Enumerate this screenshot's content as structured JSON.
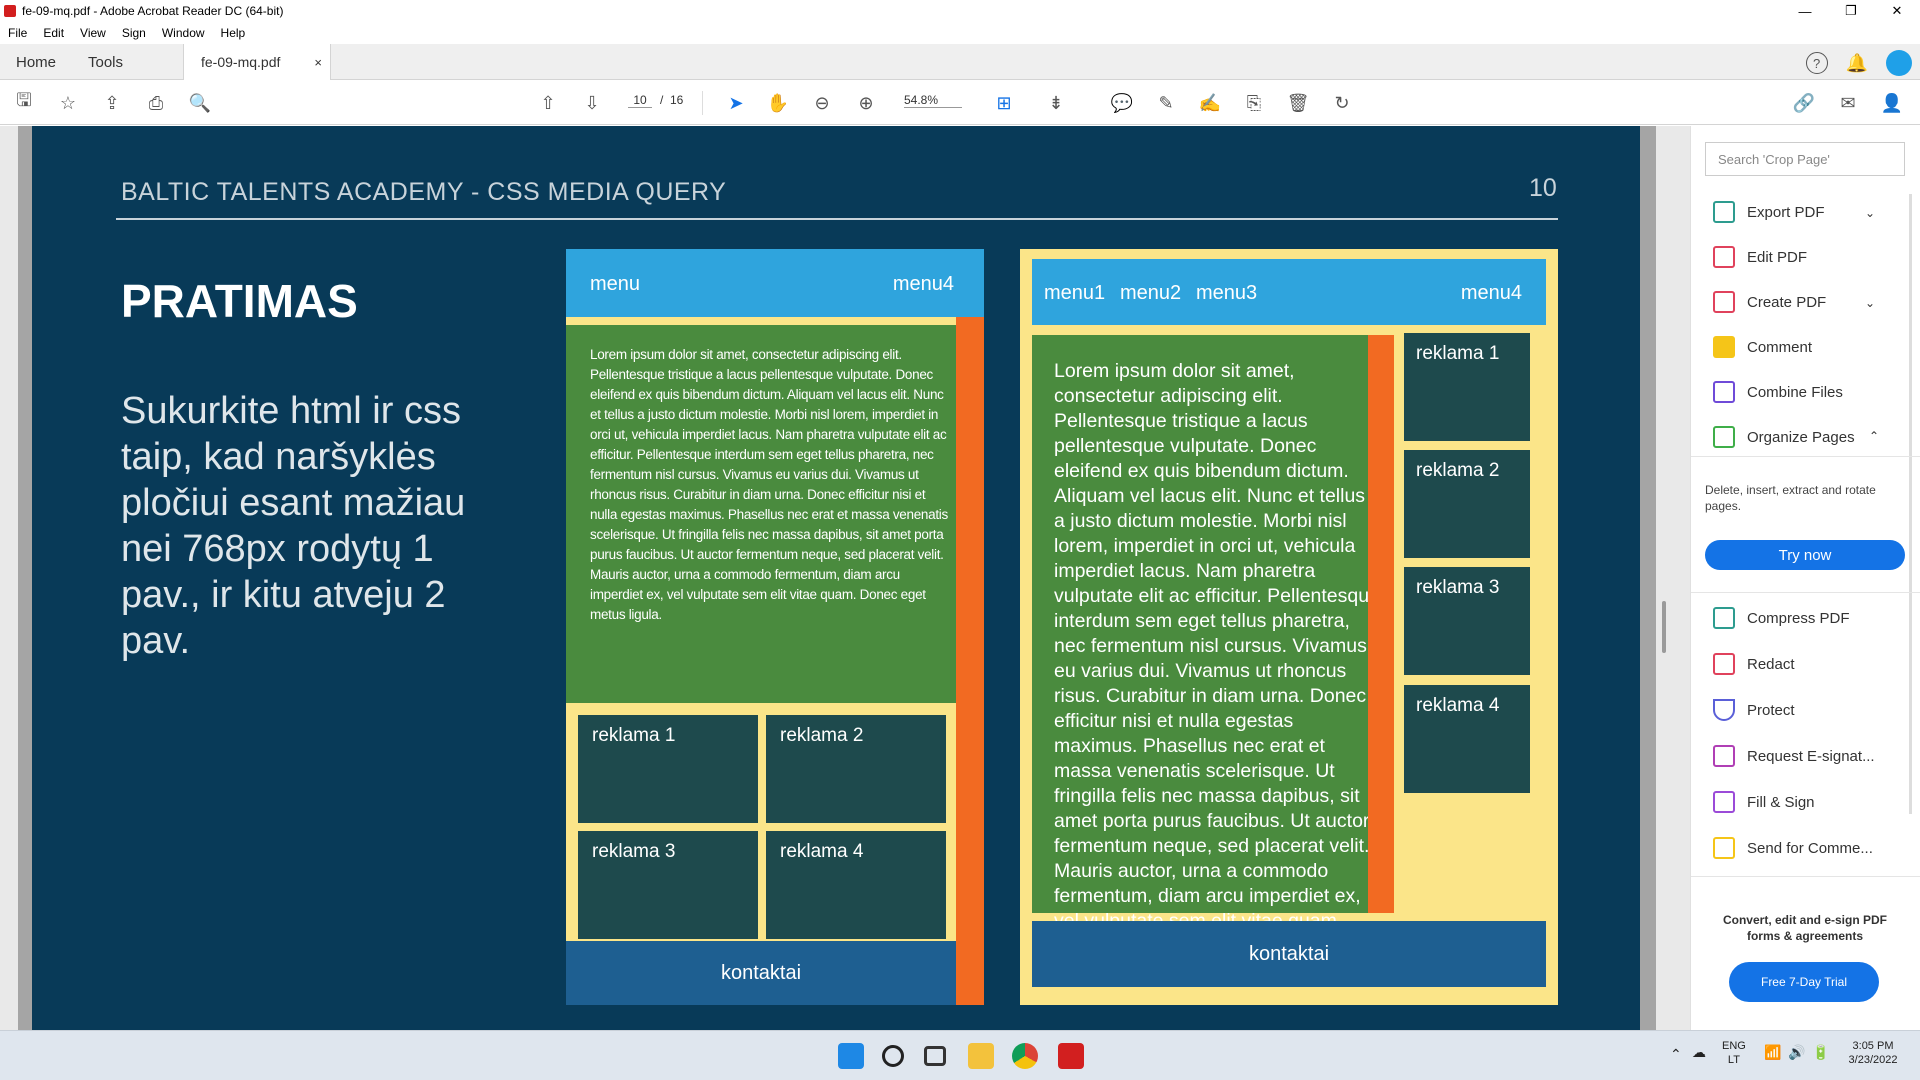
{
  "window": {
    "title": "fe-09-mq.pdf - Adobe Acrobat Reader DC (64-bit)"
  },
  "menu": [
    "File",
    "Edit",
    "View",
    "Sign",
    "Window",
    "Help"
  ],
  "tabs": {
    "home": "Home",
    "tools": "Tools",
    "doc": "fe-09-mq.pdf",
    "close": "×"
  },
  "toolbar": {
    "page_current": "10",
    "page_sep": "/",
    "page_total": "16",
    "zoom": "54.8%"
  },
  "slide": {
    "title": "BALTIC TALENTS ACADEMY - CSS MEDIA QUERY",
    "number": "10",
    "heading": "PRATIMAS",
    "body": "Sukurkite html ir css taip, kad naršyklės pločiui esant mažiau nei 768px rodytų 1 pav., ir kitu atveju 2 pav."
  },
  "figure1": {
    "menu_left": "menu",
    "menu_right": "menu4",
    "lorem": "Lorem ipsum dolor sit amet, consectetur adipiscing elit. Pellentesque tristique a lacus pellentesque vulputate. Donec eleifend ex quis bibendum dictum. Aliquam vel lacus elit. Nunc et tellus a justo dictum molestie. Morbi nisl lorem, imperdiet in orci ut, vehicula imperdiet lacus. Nam pharetra vulputate elit ac efficitur. Pellentesque interdum sem eget tellus pharetra, nec fermentum nisl cursus. Vivamus eu varius dui. Vivamus ut rhoncus risus. Curabitur in diam urna. Donec efficitur nisi et nulla egestas maximus. Phasellus nec erat et massa venenatis scelerisque. Ut fringilla felis nec massa dapibus, sit amet porta purus faucibus. Ut auctor fermentum neque, sed placerat velit. Mauris auctor, urna a commodo fermentum, diam arcu imperdiet ex, vel vulputate sem elit vitae quam. Donec eget metus ligula.",
    "ads": [
      "reklama 1",
      "reklama 2",
      "reklama 3",
      "reklama 4"
    ],
    "footer": "kontaktai"
  },
  "figure2": {
    "menu": [
      "menu1",
      "menu2",
      "menu3"
    ],
    "menu_right": "menu4",
    "lorem": "Lorem ipsum dolor sit amet, consectetur adipiscing elit. Pellentesque tristique a lacus pellentesque vulputate. Donec eleifend ex quis bibendum dictum. Aliquam vel lacus elit. Nunc et tellus a justo dictum molestie. Morbi nisl lorem, imperdiet in orci ut, vehicula imperdiet lacus. Nam pharetra vulputate elit ac efficitur. Pellentesque interdum sem eget tellus pharetra, nec fermentum nisl cursus. Vivamus eu varius dui. Vivamus ut rhoncus risus. Curabitur in diam urna. Donec efficitur nisi et nulla egestas maximus. Phasellus nec erat et massa venenatis scelerisque. Ut fringilla felis nec massa dapibus, sit amet porta purus faucibus. Ut auctor fermentum neque, sed placerat velit. Mauris auctor, urna a commodo fermentum, diam arcu imperdiet ex, vel vulputate sem elit vitae quam. Donec eget metus ligula.",
    "ads": [
      "reklama 1",
      "reklama 2",
      "reklama 3",
      "reklama 4"
    ],
    "footer": "kontaktai"
  },
  "sidepanel": {
    "search_placeholder": "Search 'Crop Page'",
    "items": [
      {
        "label": "Export PDF",
        "icon": "export-pdf-icon",
        "color": "#2d9c8f"
      },
      {
        "label": "Edit PDF",
        "icon": "edit-pdf-icon",
        "color": "#e0425c"
      },
      {
        "label": "Create PDF",
        "icon": "create-pdf-icon",
        "color": "#e0425c"
      },
      {
        "label": "Comment",
        "icon": "comment-icon",
        "color": "#f5c518"
      },
      {
        "label": "Combine Files",
        "icon": "combine-files-icon",
        "color": "#6f4bd8"
      },
      {
        "label": "Organize Pages",
        "icon": "organize-pages-icon",
        "color": "#3fae49"
      }
    ],
    "organize_desc": "Delete, insert, extract and rotate pages.",
    "try_now": "Try now",
    "items2": [
      {
        "label": "Compress PDF",
        "icon": "compress-pdf-icon",
        "color": "#2d9c8f"
      },
      {
        "label": "Redact",
        "icon": "redact-icon",
        "color": "#e0425c"
      },
      {
        "label": "Protect",
        "icon": "protect-icon",
        "color": "#5a5fd8"
      },
      {
        "label": "Request E-signat...",
        "icon": "request-esign-icon",
        "color": "#b03fb5"
      },
      {
        "label": "Fill & Sign",
        "icon": "fill-sign-icon",
        "color": "#9b4bd8"
      },
      {
        "label": "Send for Comme...",
        "icon": "send-comment-icon",
        "color": "#f5c518"
      }
    ],
    "promo": "Convert, edit and e-sign PDF forms & agreements",
    "trial": "Free 7-Day Trial"
  },
  "taskbar": {
    "lang1": "ENG",
    "lang2": "LT",
    "time": "3:05 PM",
    "date": "3/23/2022"
  },
  "colors": {
    "slide_bg": "#083a58",
    "menu_blue": "#2fa4dd",
    "content_green": "#4a8b3e",
    "ad_teal": "#1e4a4d",
    "footer_blue": "#1e5f91",
    "orange": "#f26a22",
    "yellow": "#fbe589",
    "accent": "#1473e6"
  }
}
